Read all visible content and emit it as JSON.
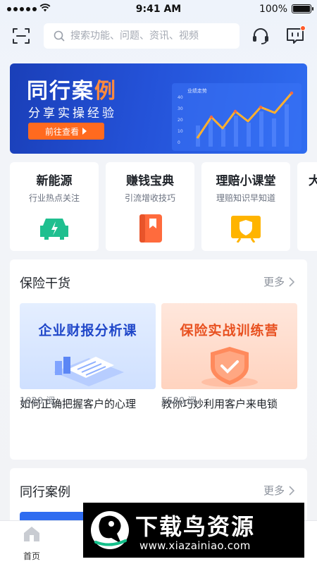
{
  "status_bar": {
    "time": "9:41 AM",
    "battery": "100%"
  },
  "search": {
    "placeholder": "搜索功能、问题、资讯、视频"
  },
  "banner": {
    "title_main": "同行案",
    "title_accent": "例",
    "subtitle": "分享实操经验",
    "button": "前往查看",
    "chart_label": "业绩走势",
    "chart_ticks": [
      "40",
      "30",
      "20",
      "10",
      "0"
    ]
  },
  "categories": [
    {
      "title": "新能源",
      "subtitle": "行业热点关注",
      "icon": "electric-car-icon",
      "color": "#1fbf8f"
    },
    {
      "title": "赚钱宝典",
      "subtitle": "引流增收技巧",
      "icon": "bookmark-book-icon",
      "color": "#ff6b3d"
    },
    {
      "title": "理赔小课堂",
      "subtitle": "理赔知识早知道",
      "icon": "shield-board-icon",
      "color": "#ffb400"
    },
    {
      "title": "大",
      "subtitle": "",
      "icon": "",
      "color": ""
    }
  ],
  "section_insurance": {
    "title": "保险干货",
    "more": "更多",
    "articles": [
      {
        "cover_text": "企业财报分析课",
        "title": "如何正确把握客户的心理",
        "reads": "1020 阅"
      },
      {
        "cover_text": "保险实战训练营",
        "title": "教你巧妙利用客户来电锁",
        "reads": "5580 阅"
      }
    ]
  },
  "section_cases": {
    "title": "同行案例",
    "more": "更多"
  },
  "tabbar": {
    "tabs": [
      "首页",
      "",
      "",
      "",
      ""
    ]
  },
  "watermark": {
    "text": "下载鸟资源",
    "url": "www.xiazainiao.com"
  },
  "colors": {
    "accent_blue": "#2452d8",
    "accent_orange": "#ff6a1f",
    "notify_dot": "#ff5a2a"
  }
}
